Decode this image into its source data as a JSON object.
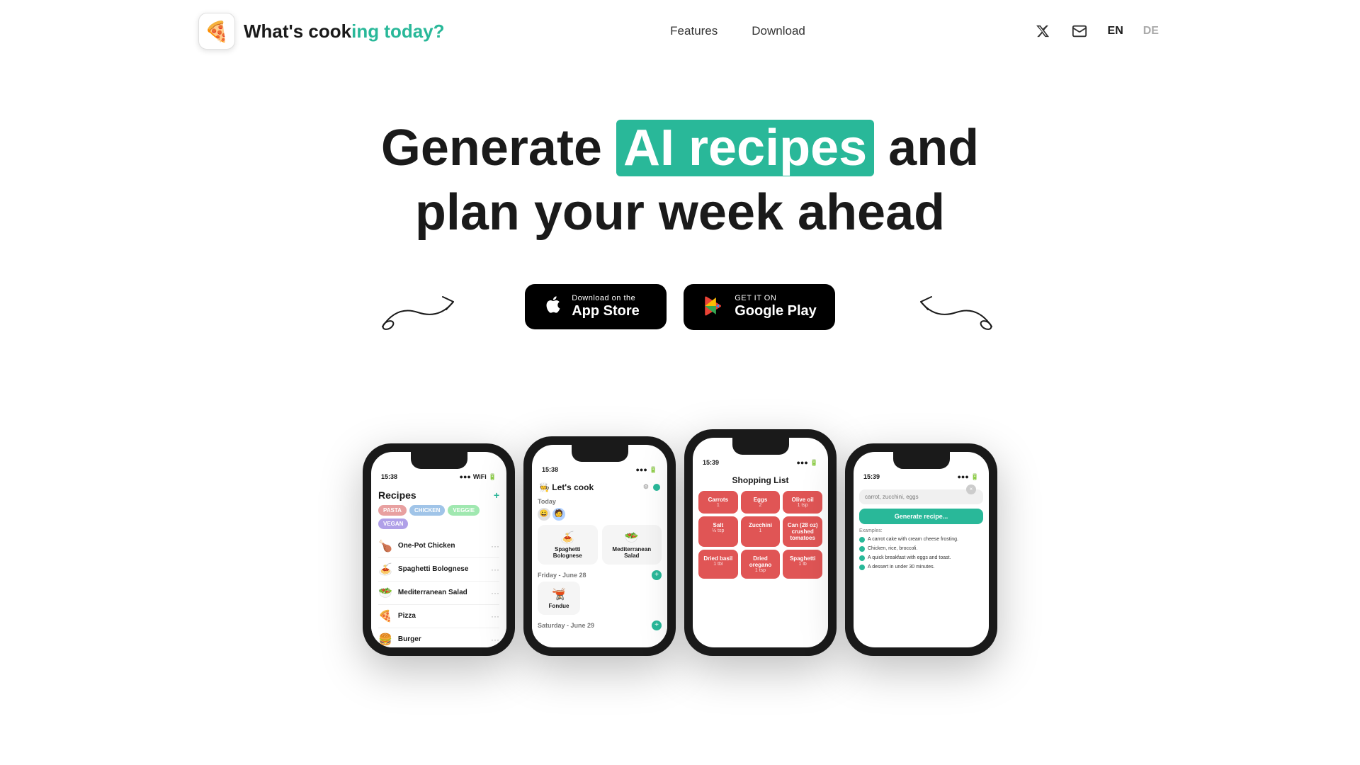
{
  "nav": {
    "logo_emoji": "🍕",
    "logo_text_plain": "What's cook",
    "logo_text_highlight": "ing today?",
    "links": [
      {
        "label": "Features",
        "id": "features"
      },
      {
        "label": "Download",
        "id": "download"
      }
    ],
    "lang_en": "EN",
    "lang_de": "DE"
  },
  "hero": {
    "line1_prefix": "Generate ",
    "line1_highlight": "AI recipes",
    "line1_suffix": " and",
    "line2": "plan your week ahead"
  },
  "cta": {
    "appstore_small": "Download on the",
    "appstore_big": "App Store",
    "googleplay_small": "GET IT ON",
    "googleplay_big": "Google Play"
  },
  "phones": {
    "phone1": {
      "time": "15:38",
      "title": "Recipes",
      "tags": [
        "PASTA",
        "CHICKEN",
        "VEGGIE",
        "VEGAN"
      ],
      "recipes": [
        {
          "emoji": "🍗",
          "name": "One-Pot Chicken"
        },
        {
          "emoji": "🍝",
          "name": "Spaghetti Bolognese"
        },
        {
          "emoji": "🥗",
          "name": "Mediterranean Salad"
        },
        {
          "emoji": "🍕",
          "name": "Pizza"
        },
        {
          "emoji": "🍔",
          "name": "Burger"
        }
      ]
    },
    "phone2": {
      "time": "15:38",
      "title": "Let's cook",
      "sections": [
        {
          "date": "Today",
          "meals": [
            {
              "emoji": "🍝",
              "name": "Spaghetti Bolognese"
            },
            {
              "emoji": "🥗",
              "name": "Mediterranean Salad"
            }
          ]
        },
        {
          "date": "Friday - June 28",
          "meals": [
            {
              "emoji": "🫕",
              "name": "Fondue"
            }
          ]
        },
        {
          "date": "Saturday - June 29",
          "meals": []
        }
      ]
    },
    "phone3": {
      "time": "15:39",
      "title": "Shopping List",
      "items": [
        {
          "name": "Carrots",
          "qty": "1"
        },
        {
          "name": "Eggs",
          "qty": "2"
        },
        {
          "name": "Olive oil",
          "qty": "1 tsp"
        },
        {
          "name": "Salt",
          "qty": "½ tsp"
        },
        {
          "name": "Zucchini",
          "qty": "1"
        },
        {
          "name": "Can (28 oz) crushed tomatoes",
          "qty": ""
        },
        {
          "name": "Dried basil",
          "qty": "1 tbl"
        },
        {
          "name": "Dried oregano",
          "qty": "1 tsp"
        },
        {
          "name": "Spaghetti",
          "qty": "1 lb"
        }
      ]
    },
    "phone4": {
      "time": "15:39",
      "input_placeholder": "carrot, zucchini, eggs",
      "generate_label": "Generate recipe...",
      "examples_label": "Examples:",
      "examples": [
        "A carrot cake with cream cheese frosting.",
        "Chicken, rice, broccoli.",
        "A quick breakfast with eggs and toast.",
        "A dessert in under 30 minutes."
      ]
    }
  }
}
